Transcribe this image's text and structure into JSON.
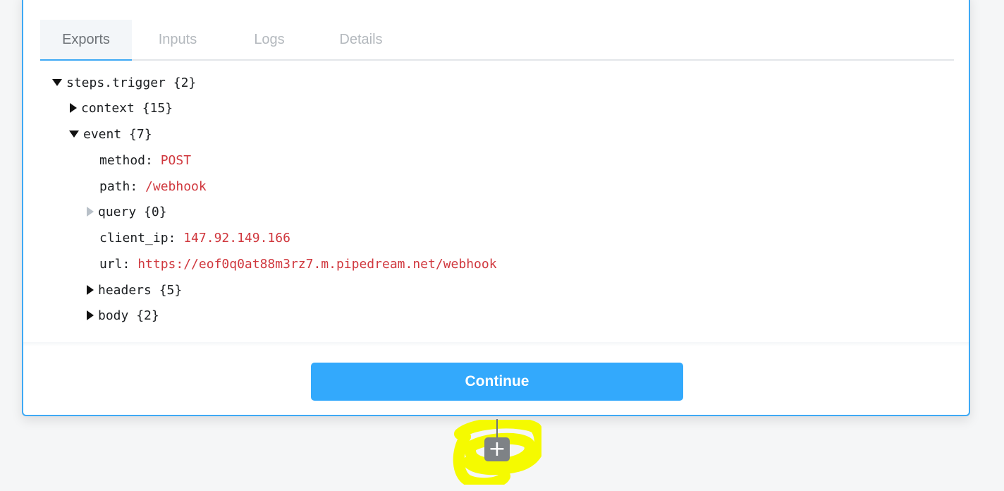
{
  "progress": {
    "fraction": 0.01,
    "color": "#2ecc71"
  },
  "tabs": [
    {
      "label": "Exports",
      "active": true
    },
    {
      "label": "Inputs",
      "active": false
    },
    {
      "label": "Logs",
      "active": false
    },
    {
      "label": "Details",
      "active": false
    }
  ],
  "tree": {
    "root": {
      "key": "steps.trigger",
      "count": "{2}"
    },
    "context": {
      "key": "context",
      "count": "{15}"
    },
    "event": {
      "key": "event",
      "count": "{7}"
    },
    "method": {
      "key": "method:",
      "value": "POST"
    },
    "path": {
      "key": "path:",
      "value": "/webhook"
    },
    "query": {
      "key": "query",
      "count": "{0}"
    },
    "client_ip": {
      "key": "client_ip:",
      "value": "147.92.149.166"
    },
    "url": {
      "key": "url:",
      "value": "https://eof0q0at88m3rz7.m.pipedream.net/webhook"
    },
    "headers": {
      "key": "headers",
      "count": "{5}"
    },
    "body": {
      "key": "body",
      "count": "{2}"
    }
  },
  "footer": {
    "continue_label": "Continue"
  },
  "add_step": {
    "icon": "plus-icon",
    "glyph": "+"
  },
  "colors": {
    "accent": "#33a9fc",
    "value_text": "#d0383e",
    "highlight": "#f5fa00"
  }
}
